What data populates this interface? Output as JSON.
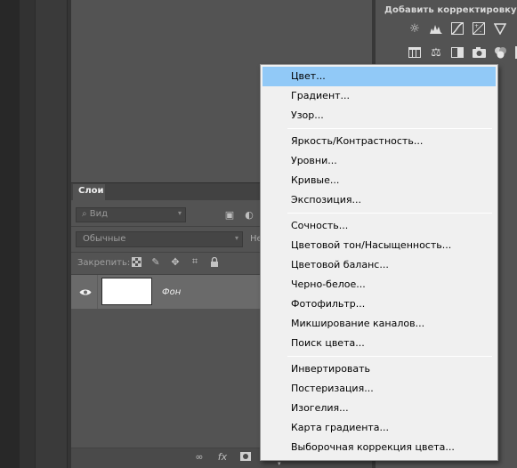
{
  "adjustments": {
    "title": "Добавить корректировку",
    "row1_icons": [
      "brightness-contrast-icon",
      "levels-icon",
      "curves-icon",
      "exposure-icon",
      "vibrance-icon"
    ],
    "row2_icons": [
      "hue-saturation-icon",
      "color-balance-icon",
      "black-white-icon",
      "photo-filter-icon",
      "channel-mixer-icon",
      "color-lookup-icon"
    ]
  },
  "layers": {
    "tab_label": "Слои",
    "filter_placeholder": "Вид",
    "blend_mode": "Обычные",
    "opacity_label": "Не",
    "lock_label": "Закрепить:",
    "layer_name": "Фон"
  },
  "menu": {
    "groups": [
      [
        "Цвет...",
        "Градиент...",
        "Узор..."
      ],
      [
        "Яркость/Контрастность...",
        "Уровни...",
        "Кривые...",
        "Экспозиция..."
      ],
      [
        "Сочность...",
        "Цветовой тон/Насыщенность...",
        "Цветовой баланс...",
        "Черно-белое...",
        "Фотофильтр...",
        "Микширование каналов...",
        "Поиск цвета..."
      ],
      [
        "Инвертировать",
        "Постеризация...",
        "Изогелия...",
        "Карта градиента...",
        "Выборочная коррекция цвета..."
      ]
    ],
    "selected": "Цвет..."
  },
  "colors": {
    "menu_highlight": "#91c9f7",
    "panel_bg": "#535353",
    "layer_selected": "#6a6a6a"
  }
}
